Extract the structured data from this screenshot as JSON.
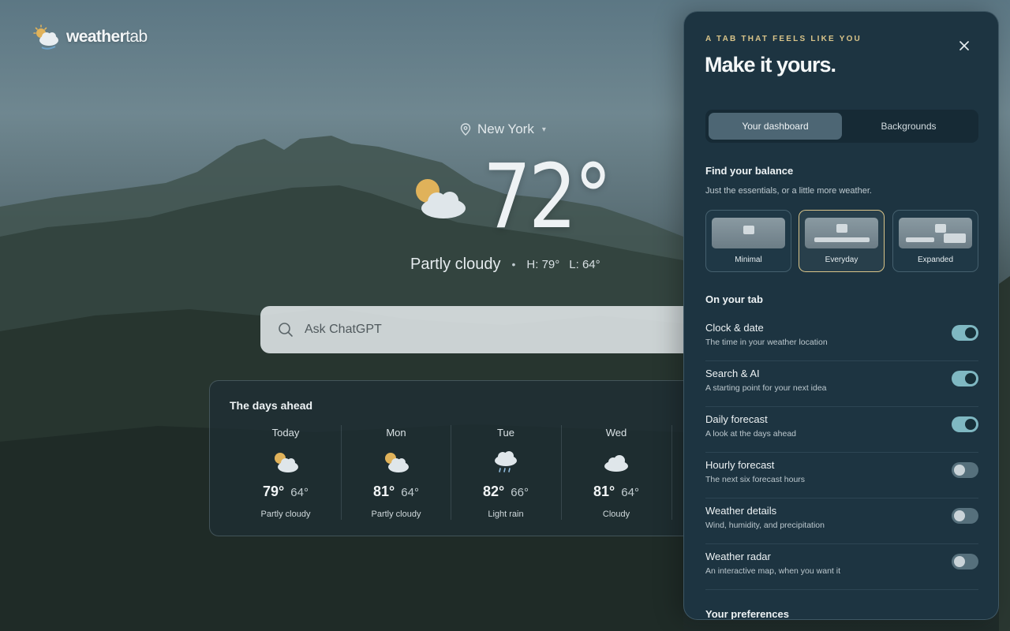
{
  "app": {
    "logo_bold": "weather",
    "logo_light": "tab"
  },
  "weather": {
    "location": "New York",
    "temperature": "72°",
    "condition": "Partly cloudy",
    "separator": "•",
    "high": "H: 79°",
    "low": "L: 64°"
  },
  "search": {
    "placeholder": "Ask ChatGPT"
  },
  "forecast": {
    "title": "The days ahead",
    "days": [
      {
        "name": "Today",
        "icon": "partly-cloudy-icon",
        "high": "79°",
        "low": "64°",
        "desc": "Partly cloudy"
      },
      {
        "name": "Mon",
        "icon": "partly-cloudy-icon",
        "high": "81°",
        "low": "64°",
        "desc": "Partly cloudy"
      },
      {
        "name": "Tue",
        "icon": "rain-icon",
        "high": "82°",
        "low": "66°",
        "desc": "Light rain"
      },
      {
        "name": "Wed",
        "icon": "cloud-icon",
        "high": "81°",
        "low": "64°",
        "desc": "Cloudy"
      }
    ]
  },
  "panel": {
    "eyebrow": "A TAB THAT FEELS LIKE YOU",
    "title": "Make it yours.",
    "tabs": [
      {
        "label": "Your dashboard",
        "active": true
      },
      {
        "label": "Backgrounds",
        "active": false
      }
    ],
    "balance": {
      "title": "Find your balance",
      "subtitle": "Just the essentials, or a little more weather.",
      "options": [
        {
          "label": "Minimal",
          "selected": false
        },
        {
          "label": "Everyday",
          "selected": true
        },
        {
          "label": "Expanded",
          "selected": false
        }
      ]
    },
    "on_tab": {
      "title": "On your tab",
      "items": [
        {
          "title": "Clock & date",
          "subtitle": "The time in your weather location",
          "on": true
        },
        {
          "title": "Search & AI",
          "subtitle": "A starting point for your next idea",
          "on": true
        },
        {
          "title": "Daily forecast",
          "subtitle": "A look at the days ahead",
          "on": true
        },
        {
          "title": "Hourly forecast",
          "subtitle": "The next six forecast hours",
          "on": false
        },
        {
          "title": "Weather details",
          "subtitle": "Wind, humidity, and precipitation",
          "on": false
        },
        {
          "title": "Weather radar",
          "subtitle": "An interactive map, when you want it",
          "on": false
        }
      ]
    },
    "preferences": {
      "title": "Your preferences"
    }
  },
  "colors": {
    "panel_bg": "#1d3441",
    "accent_gold": "#d9c489",
    "toggle_on": "#7fb8c2",
    "sun": "#e0b25a"
  }
}
